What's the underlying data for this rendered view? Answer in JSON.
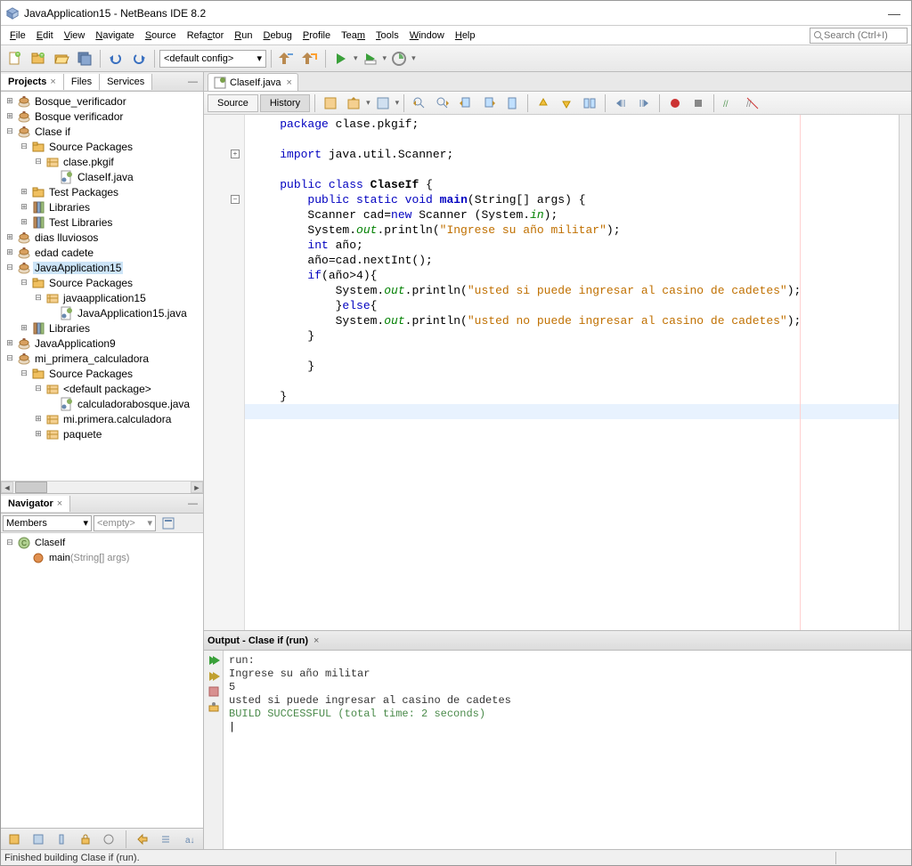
{
  "title": "JavaApplication15 - NetBeans IDE 8.2",
  "menu": [
    "File",
    "Edit",
    "View",
    "Navigate",
    "Source",
    "Refactor",
    "Run",
    "Debug",
    "Profile",
    "Team",
    "Tools",
    "Window",
    "Help"
  ],
  "menu_underline": [
    0,
    0,
    0,
    0,
    0,
    4,
    0,
    0,
    0,
    3,
    0,
    0,
    0
  ],
  "search_placeholder": "Search (Ctrl+I)",
  "config_label": "<default config>",
  "left_tabs": [
    "Projects",
    "Files",
    "Services"
  ],
  "project_tree": [
    {
      "d": 0,
      "tw": "+",
      "icon": "proj",
      "label": "Bosque_verificador"
    },
    {
      "d": 0,
      "tw": "+",
      "icon": "proj",
      "label": "Bosque verificador"
    },
    {
      "d": 0,
      "tw": "-",
      "icon": "proj",
      "label": "Clase if"
    },
    {
      "d": 1,
      "tw": "-",
      "icon": "pkg",
      "label": "Source Packages"
    },
    {
      "d": 2,
      "tw": "-",
      "icon": "pkgf",
      "label": "clase.pkgif"
    },
    {
      "d": 3,
      "tw": "",
      "icon": "java",
      "label": "ClaseIf.java"
    },
    {
      "d": 1,
      "tw": "+",
      "icon": "pkg",
      "label": "Test Packages"
    },
    {
      "d": 1,
      "tw": "+",
      "icon": "lib",
      "label": "Libraries"
    },
    {
      "d": 1,
      "tw": "+",
      "icon": "lib",
      "label": "Test Libraries"
    },
    {
      "d": 0,
      "tw": "+",
      "icon": "proj",
      "label": "dias lluviosos"
    },
    {
      "d": 0,
      "tw": "+",
      "icon": "proj",
      "label": "edad cadete"
    },
    {
      "d": 0,
      "tw": "-",
      "icon": "proj",
      "label": "JavaApplication15",
      "sel": true
    },
    {
      "d": 1,
      "tw": "-",
      "icon": "pkg",
      "label": "Source Packages"
    },
    {
      "d": 2,
      "tw": "-",
      "icon": "pkgf",
      "label": "javaapplication15"
    },
    {
      "d": 3,
      "tw": "",
      "icon": "java",
      "label": "JavaApplication15.java"
    },
    {
      "d": 1,
      "tw": "+",
      "icon": "lib",
      "label": "Libraries"
    },
    {
      "d": 0,
      "tw": "+",
      "icon": "proj",
      "label": "JavaApplication9"
    },
    {
      "d": 0,
      "tw": "-",
      "icon": "proj",
      "label": "mi_primera_calculadora"
    },
    {
      "d": 1,
      "tw": "-",
      "icon": "pkg",
      "label": "Source Packages"
    },
    {
      "d": 2,
      "tw": "-",
      "icon": "pkgf",
      "label": "<default package>"
    },
    {
      "d": 3,
      "tw": "",
      "icon": "java",
      "label": "calculadorabosque.java"
    },
    {
      "d": 2,
      "tw": "+",
      "icon": "pkgf",
      "label": "mi.primera.calculadora"
    },
    {
      "d": 2,
      "tw": "+",
      "icon": "pkgf",
      "label": "paquete"
    }
  ],
  "navigator_title": "Navigator",
  "nav_members": "Members",
  "nav_empty": "<empty>",
  "nav_tree": [
    {
      "d": 0,
      "tw": "-",
      "icon": "class",
      "label": "ClaseIf"
    },
    {
      "d": 1,
      "tw": "",
      "icon": "method",
      "label": "main",
      "sig": "(String[] args)"
    }
  ],
  "editor_tab": "ClaseIf.java",
  "view_tabs": [
    "Source",
    "History"
  ],
  "code_lines": [
    {
      "t": "package ",
      "cls": "kw",
      "rest": "clase.pkgif;"
    },
    {
      "blank": true
    },
    {
      "t": "import ",
      "cls": "kw",
      "rest": "java.util.Scanner;",
      "fold": "+"
    },
    {
      "blank": true
    },
    {
      "raw": "<span class='kw'>public class</span> <span class='bold'>ClaseIf</span> {"
    },
    {
      "indent": 1,
      "raw": "<span class='kw'>public static void</span> <span class='bold kwb'>main</span>(String[] args) {",
      "fold": "-"
    },
    {
      "indent": 1,
      "raw": "Scanner cad=<span class='kw'>new</span> Scanner (System.<span class='fld'>in</span>);"
    },
    {
      "indent": 1,
      "raw": "System.<span class='fld'>out</span>.println(<span class='str'>\"Ingrese su año militar\"</span>);"
    },
    {
      "indent": 1,
      "raw": "<span class='kw'>int</span> año;"
    },
    {
      "indent": 1,
      "raw": "año=cad.nextInt();"
    },
    {
      "indent": 1,
      "raw": "<span class='kw'>if</span>(año>4){"
    },
    {
      "indent": 2,
      "raw": "System.<span class='fld'>out</span>.println(<span class='str'>\"usted si puede ingresar al casino de cadetes\"</span>);"
    },
    {
      "indent": 2,
      "raw": "}<span class='kw'>else</span>{"
    },
    {
      "indent": 2,
      "raw": "System.<span class='fld'>out</span>.println(<span class='str'>\"usted no puede ingresar al casino de cadetes\"</span>);"
    },
    {
      "indent": 1,
      "raw": "}"
    },
    {
      "blank": true
    },
    {
      "indent": 1,
      "raw": "}"
    },
    {
      "blank": true
    },
    {
      "raw": "}"
    }
  ],
  "output_title": "Output - Clase if (run)",
  "output_lines": [
    {
      "txt": "run:"
    },
    {
      "txt": "Ingrese su año militar"
    },
    {
      "txt": "5"
    },
    {
      "txt": "usted si puede ingresar al casino de cadetes"
    },
    {
      "txt": "BUILD SUCCESSFUL (total time: 2 seconds)",
      "cls": "green"
    }
  ],
  "status": "Finished building Clase if (run)."
}
